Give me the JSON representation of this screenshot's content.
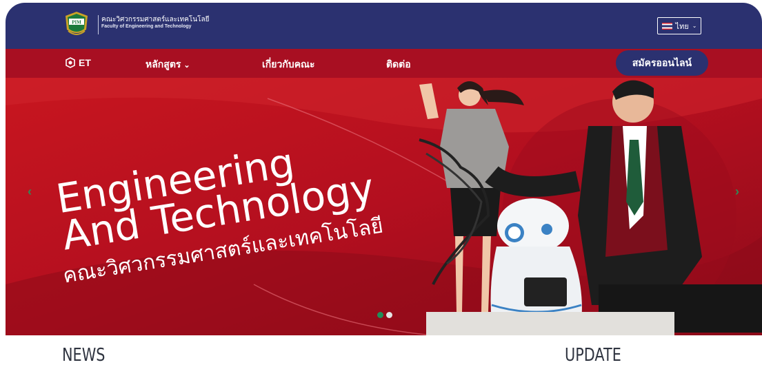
{
  "header": {
    "faculty_th": "คณะวิศวกรรมศาสตร์และเทคโนโลยี",
    "faculty_en": "Faculty of Engineering and Technology",
    "logo_text": "PIM",
    "language": "ไทย"
  },
  "nav": {
    "brand": "ET",
    "items": [
      "หลักสูตร",
      "เกี่ยวกับคณะ",
      "ติดต่อ"
    ],
    "apply": "สมัครออนไลน์"
  },
  "hero": {
    "title_line1": "Engineering",
    "title_line2": "And Technology",
    "subtitle": "คณะวิศวกรรมศาสตร์และเทคโนโลยี",
    "prev_icon": "chevron-left-icon",
    "next_icon": "chevron-right-icon",
    "slides": 2,
    "active_slide": 1
  },
  "sections": {
    "news": "NEWS",
    "update": "UPDATE"
  },
  "colors": {
    "header_bg": "#2b3170",
    "nav_bg": "#a80f22",
    "hero_bg": "#b5121f",
    "accent_green": "#1f8f5a"
  }
}
